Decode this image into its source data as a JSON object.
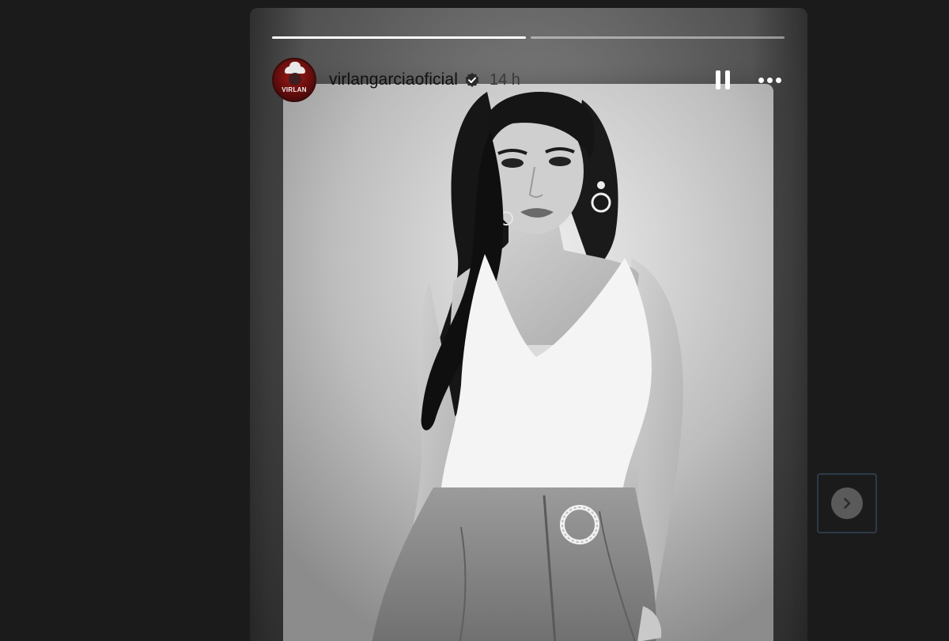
{
  "story": {
    "progress": [
      1.0,
      0.0
    ],
    "username": "virlangarciaoficial",
    "time_ago": "14 h",
    "avatar_text": "VIRLAN",
    "verified": true
  },
  "icons": {
    "verified": "verified-badge-icon",
    "pause": "pause-icon",
    "more": "more-options-icon",
    "next": "chevron-right-icon"
  },
  "colors": {
    "page_background": "#1b1b1b",
    "progress_filled": "#ffffff",
    "progress_empty": "#9a9a9a",
    "avatar_red": "#a31818"
  }
}
